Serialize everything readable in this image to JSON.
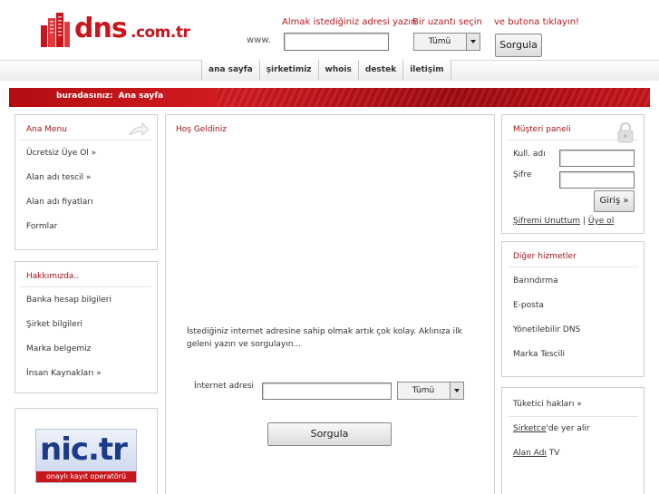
{
  "header": {
    "logo_text": "dns",
    "logo_suffix": ".com.tr",
    "hint_1": "Almak istediğiniz adresi yazın",
    "hint_2": "Bir uzantı seçin",
    "hint_3": "ve butona tıklayın!",
    "www_label": "www.",
    "domain_input_value": "",
    "tld_select_value": "Tümü",
    "search_button": "Sorgula"
  },
  "nav": {
    "items": [
      "ana sayfa",
      "şirketimiz",
      "whois",
      "destek",
      "iletişim"
    ]
  },
  "breadcrumb": {
    "label": "buradasınız:",
    "current": "Ana sayfa"
  },
  "left": {
    "main_menu": {
      "title": "Ana Menu",
      "items": [
        "Ücretsiz Üye Ol »",
        "Alan adı tescil »",
        "Alan adı fiyatları",
        "Formlar"
      ]
    },
    "about": {
      "title": "Hakkımızda..",
      "items": [
        "Banka hesap bilgileri",
        "Şirket bilgileri",
        "Marka belgemiz",
        "İnsan Kaynakları »"
      ]
    },
    "nic_logo": {
      "text": "nic.tr",
      "sub": "onaylı kayıt operatörü"
    }
  },
  "center": {
    "title": "Hoş Geldiniz",
    "intro": "İstediğiniz internet adresine sahip olmak artık çok kolay. Aklınıza ilk geleni yazın ve  sorgulayın...",
    "address_label": "İnternet adresi",
    "address_value": "",
    "tld_select_value": "Tümü",
    "search_button": "Sorgula"
  },
  "right": {
    "customer_panel": {
      "title": "Müşteri paneli",
      "username_label": "Kull. adı",
      "password_label": "Şifre",
      "username_value": "",
      "password_value": "",
      "login_button": "Giriş »",
      "forgot_link": "Şifremi Unuttum",
      "separator": "|",
      "signup_link": "Üye ol"
    },
    "other_services": {
      "title": "Diğer hizmetler",
      "items": [
        "Barındırma",
        "E-posta",
        "Yönetilebilir DNS",
        "Marka Tescili"
      ]
    },
    "extra": {
      "consumer_rights": "Tüketici hakları »",
      "sirketce_link": "Sirketce",
      "sirketce_suffix": "'de yer alir",
      "alanadi_link": "Alan Adı",
      "alanadi_suffix": " TV"
    }
  },
  "colors": {
    "brand_red": "#c8161d",
    "title_red": "#a3141a"
  }
}
